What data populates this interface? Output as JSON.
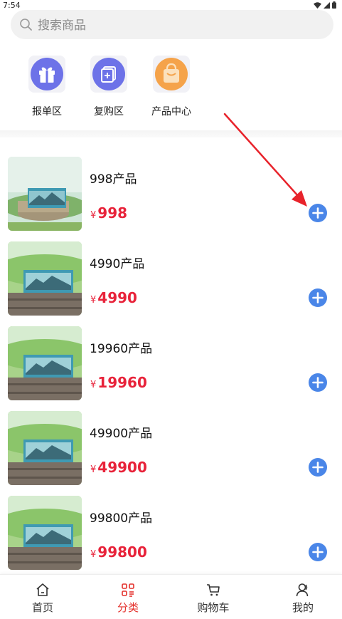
{
  "status_bar": {
    "time": "7:54"
  },
  "search": {
    "placeholder": "搜索商品"
  },
  "categories": [
    {
      "label": "报单区",
      "icon": "gift-icon",
      "color": "#6d72e8"
    },
    {
      "label": "复购区",
      "icon": "layers-add-icon",
      "color": "#6d72e8"
    },
    {
      "label": "产品中心",
      "icon": "shopping-bag-icon",
      "color": "#f5a34a"
    }
  ],
  "products": [
    {
      "name": "998产品",
      "currency": "¥",
      "price": "998"
    },
    {
      "name": "4990产品",
      "currency": "¥",
      "price": "4990"
    },
    {
      "name": "19960产品",
      "currency": "¥",
      "price": "19960"
    },
    {
      "name": "49900产品",
      "currency": "¥",
      "price": "49900"
    },
    {
      "name": "99800产品",
      "currency": "¥",
      "price": "99800"
    }
  ],
  "tabs": [
    {
      "label": "首页",
      "icon": "home-icon"
    },
    {
      "label": "分类",
      "icon": "category-icon",
      "active": true
    },
    {
      "label": "购物车",
      "icon": "cart-icon"
    },
    {
      "label": "我的",
      "icon": "user-icon"
    }
  ],
  "colors": {
    "accent": "#e4302b",
    "price": "#e8233a",
    "add_button": "#4a86e8",
    "annotation_arrow": "#e8232b"
  }
}
